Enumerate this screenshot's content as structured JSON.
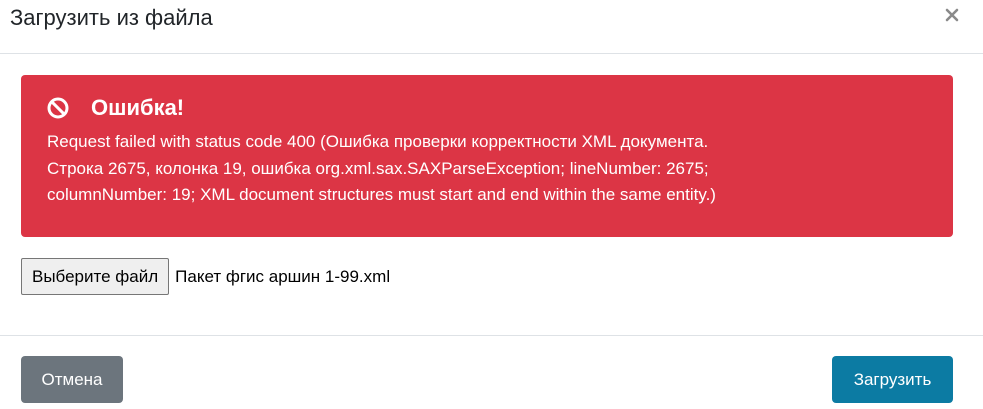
{
  "modal": {
    "title": "Загрузить из файла",
    "close_icon": "close-icon"
  },
  "alert": {
    "icon": "ban-icon",
    "title": "Ошибка!",
    "message_lines": [
      "Request failed with status code 400 (Ошибка проверки корректности XML документа.",
      "Строка 2675, колонка 19, ошибка org.xml.sax.SAXParseException; lineNumber: 2675;",
      "columnNumber: 19; XML document structures must start and end within the same entity.)"
    ],
    "color": "#dc3545"
  },
  "file_input": {
    "button_label": "Выберите файл",
    "selected_file": "Пакет фгис аршин 1-99.xml"
  },
  "footer": {
    "cancel_label": "Отмена",
    "upload_label": "Загрузить",
    "cancel_color": "#6c757d",
    "upload_color": "#0c7ba3"
  }
}
